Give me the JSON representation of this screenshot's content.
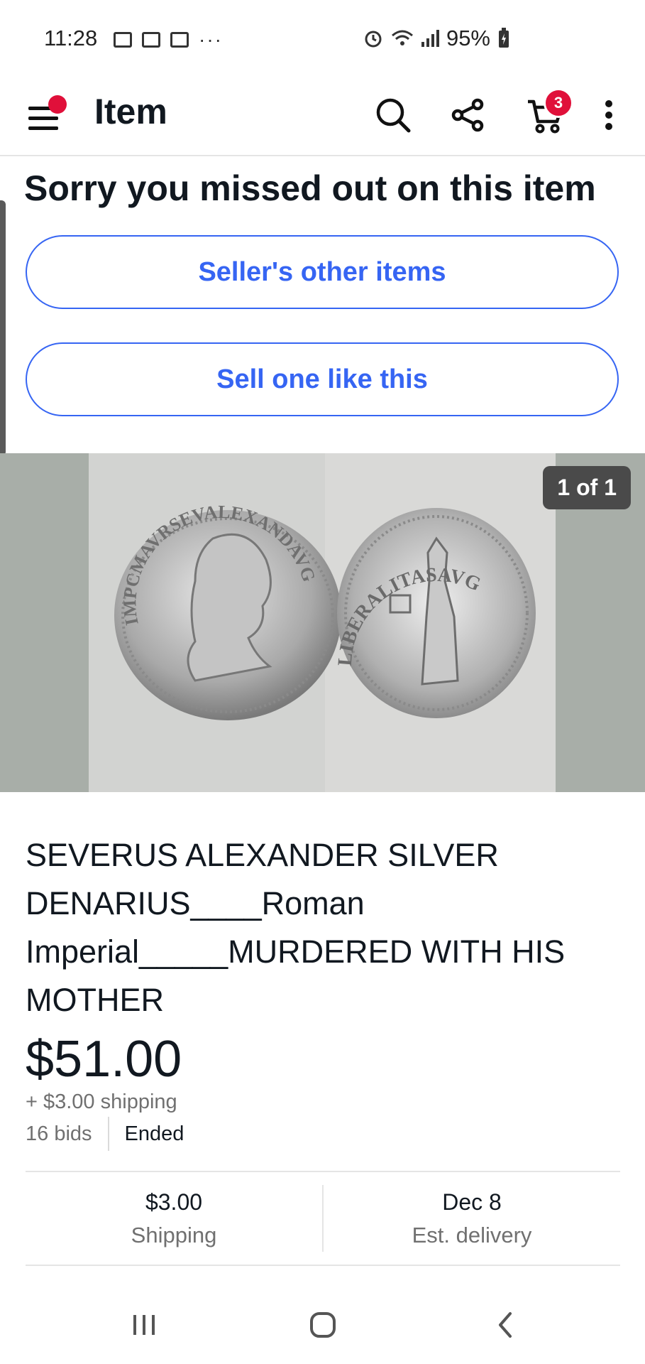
{
  "status_bar": {
    "time": "11:28",
    "battery": "95%",
    "left_icons": [
      "mail-icon",
      "gallery-icon",
      "screen-cast-icon",
      "more-dots-icon"
    ],
    "right_icons": [
      "alarm-icon",
      "wifi-icon",
      "signal-icon",
      "battery-charging-icon"
    ]
  },
  "app_bar": {
    "title": "Item",
    "cart_count": "3",
    "icons": [
      "menu-icon",
      "search-icon",
      "share-icon",
      "cart-icon",
      "overflow-menu-icon"
    ],
    "accent_color": "#3665f3",
    "badge_color": "#e0103a"
  },
  "listing": {
    "missed_heading": "Sorry you missed out on this item",
    "sellers_items_label": "Seller's other items",
    "sell_one_label": "Sell one like this",
    "image_counter": "1 of 1",
    "coin_obverse_text": "IMPCMAVRSEVALEXANDAVG",
    "coin_reverse_text": "LIBERALITASAVG",
    "title": "SEVERUS ALEXANDER SILVER DENARIUS____Roman Imperial_____MURDERED WITH HIS MOTHER",
    "price": "$51.00",
    "shipping_line": "+ $3.00 shipping",
    "bids": "16 bids",
    "status": "Ended"
  },
  "info": {
    "shipping_value": "$3.00",
    "shipping_label": "Shipping",
    "delivery_value": "Dec 8",
    "delivery_label": "Est. delivery"
  },
  "nav_bar": {
    "icons": [
      "recent-apps-icon",
      "home-icon",
      "back-icon"
    ]
  }
}
